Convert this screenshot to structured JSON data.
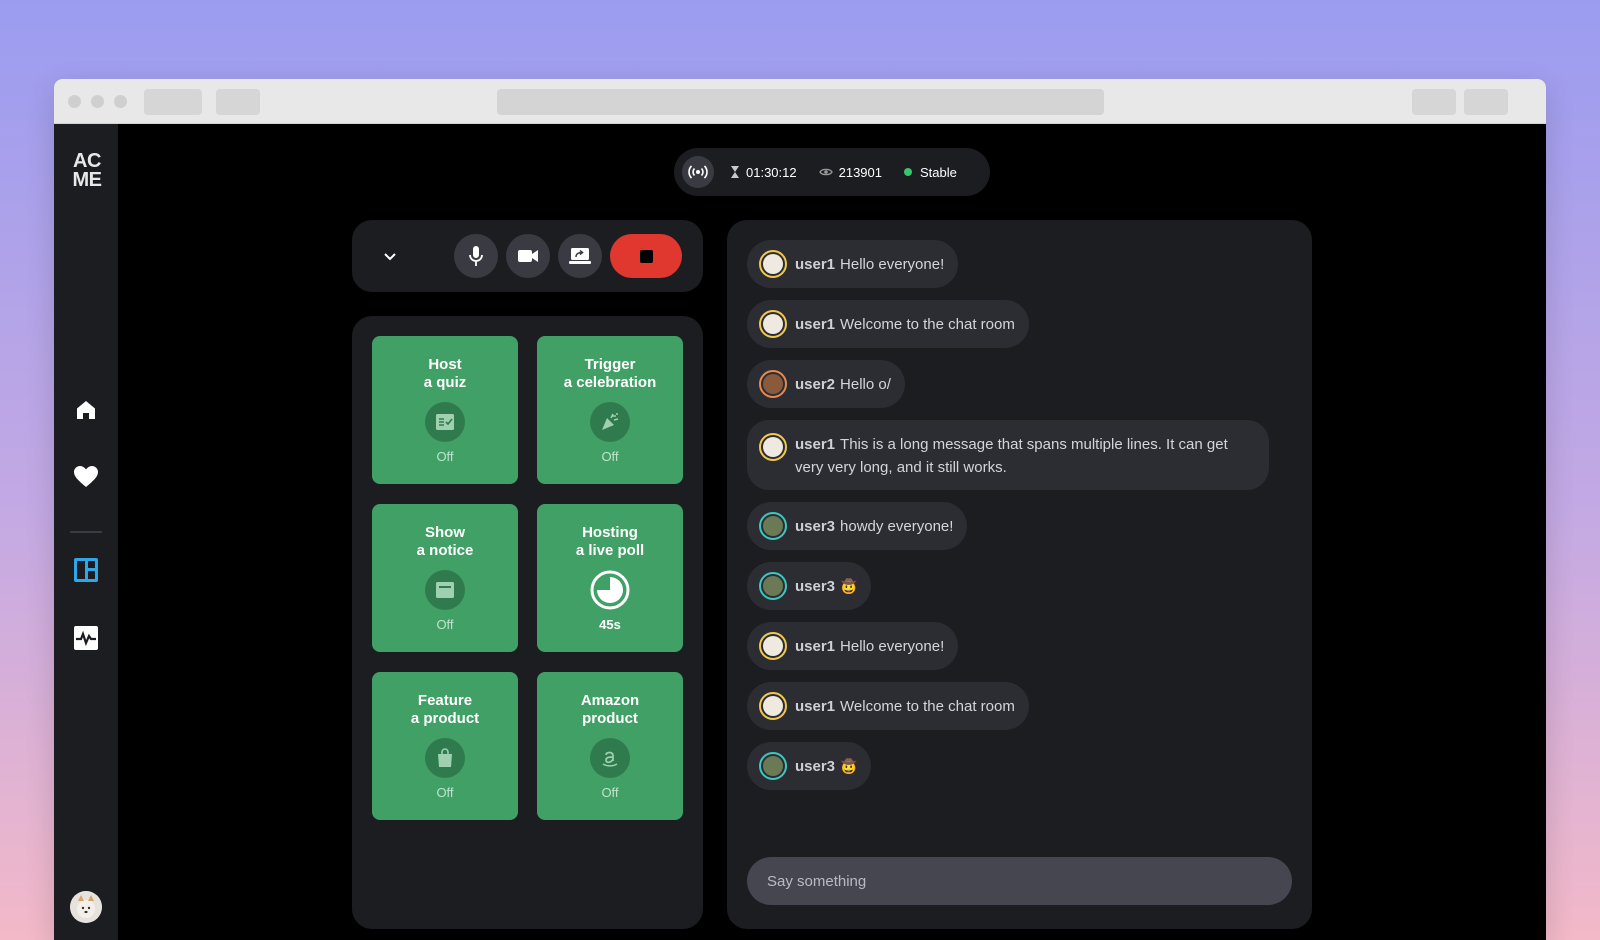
{
  "app": {
    "logo_line1": "AC",
    "logo_line2": "ME"
  },
  "sidebar": {
    "items": [
      {
        "name": "home",
        "icon": "home-icon"
      },
      {
        "name": "favorites",
        "icon": "heart-icon"
      },
      {
        "name": "dashboard",
        "icon": "dashboard-icon",
        "active": true
      },
      {
        "name": "activity",
        "icon": "activity-icon"
      }
    ]
  },
  "status": {
    "duration": "01:30:12",
    "viewers": "213901",
    "connection": "Stable"
  },
  "colors": {
    "accent_green": "#41a065",
    "stop_red": "#e0382f",
    "active_blue": "#2fa6e8",
    "status_green": "#37c46c"
  },
  "actions": [
    {
      "title_line1": "Host",
      "title_line2": "a quiz",
      "icon": "quiz-icon",
      "status": "Off"
    },
    {
      "title_line1": "Trigger",
      "title_line2": "a celebration",
      "icon": "party-popper-icon",
      "status": "Off"
    },
    {
      "title_line1": "Show",
      "title_line2": "a notice",
      "icon": "notice-icon",
      "status": "Off"
    },
    {
      "title_line1": "Hosting",
      "title_line2": "a live poll",
      "icon": "pie-timer-icon",
      "status": "45s"
    },
    {
      "title_line1": "Feature",
      "title_line2": "a product",
      "icon": "shopping-bag-icon",
      "status": "Off"
    },
    {
      "title_line1": "Amazon",
      "title_line2": "product",
      "icon": "amazon-icon",
      "status": "Off"
    }
  ],
  "chat": {
    "messages": [
      {
        "user": "user1",
        "text": "Hello everyone!"
      },
      {
        "user": "user1",
        "text": "Welcome to the chat room"
      },
      {
        "user": "user2",
        "text": "Hello o/"
      },
      {
        "user": "user1",
        "text": "This is a long message that spans multiple lines. It can get very very long, and it still works."
      },
      {
        "user": "user3",
        "text": "howdy everyone!"
      },
      {
        "user": "user3",
        "text": "🤠"
      },
      {
        "user": "user1",
        "text": "Hello everyone!"
      },
      {
        "user": "user1",
        "text": "Welcome to the chat room"
      },
      {
        "user": "user3",
        "text": "🤠"
      }
    ],
    "input_placeholder": "Say something"
  }
}
